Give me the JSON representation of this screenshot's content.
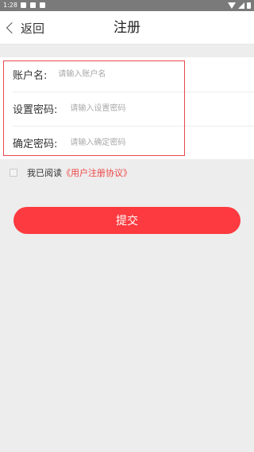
{
  "status_bar": {
    "time": "1:28"
  },
  "nav": {
    "back_label": "返回",
    "title": "注册"
  },
  "form": {
    "account": {
      "label": "账户名:",
      "placeholder": "请输入账户名"
    },
    "password": {
      "label": "设置密码:",
      "placeholder": "请输入设置密码"
    },
    "confirm": {
      "label": "确定密码:",
      "placeholder": "请输入确定密码"
    }
  },
  "agreement": {
    "prefix": "我已阅读",
    "link_text": "《用户注册协议》",
    "checked": false
  },
  "submit_label": "提交",
  "colors": {
    "accent": "#fc3a3f",
    "highlight_border": "#e5484d",
    "background": "#ededed"
  },
  "icons": {
    "back": "chevron-left-icon",
    "wifi": "wifi-icon",
    "signal": "signal-icon",
    "battery": "battery-icon"
  }
}
